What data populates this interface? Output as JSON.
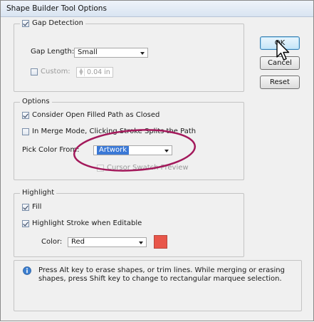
{
  "window": {
    "title": "Shape Builder Tool Options"
  },
  "buttons": {
    "ok": "OK",
    "cancel": "Cancel",
    "reset": "Reset"
  },
  "gap_detection": {
    "label": "Gap Detection",
    "checked": true,
    "gap_length_label": "Gap Length:",
    "gap_length_value": "Small",
    "custom_label": "Custom:",
    "custom_value": "0.04 in"
  },
  "options": {
    "legend": "Options",
    "consider_open_filled": "Consider Open Filled Path as Closed",
    "merge_mode": "In Merge Mode, Clicking Stroke Splits the Path",
    "pick_color_label": "Pick Color From:",
    "pick_color_value": "Artwork",
    "cursor_swatch_preview": "Cursor Swatch Preview"
  },
  "highlight": {
    "legend": "Highlight",
    "fill": "Fill",
    "highlight_stroke": "Highlight Stroke when Editable",
    "color_label": "Color:",
    "color_value": "Red",
    "swatch_color": "#e8564a"
  },
  "info": {
    "text": "Press Alt key to erase shapes, or trim lines. While merging or erasing shapes, press Shift key to change to rectangular marquee selection."
  },
  "colors": {
    "annotation_ellipse": "#a3195b",
    "selection_blue": "#3a78d6"
  }
}
